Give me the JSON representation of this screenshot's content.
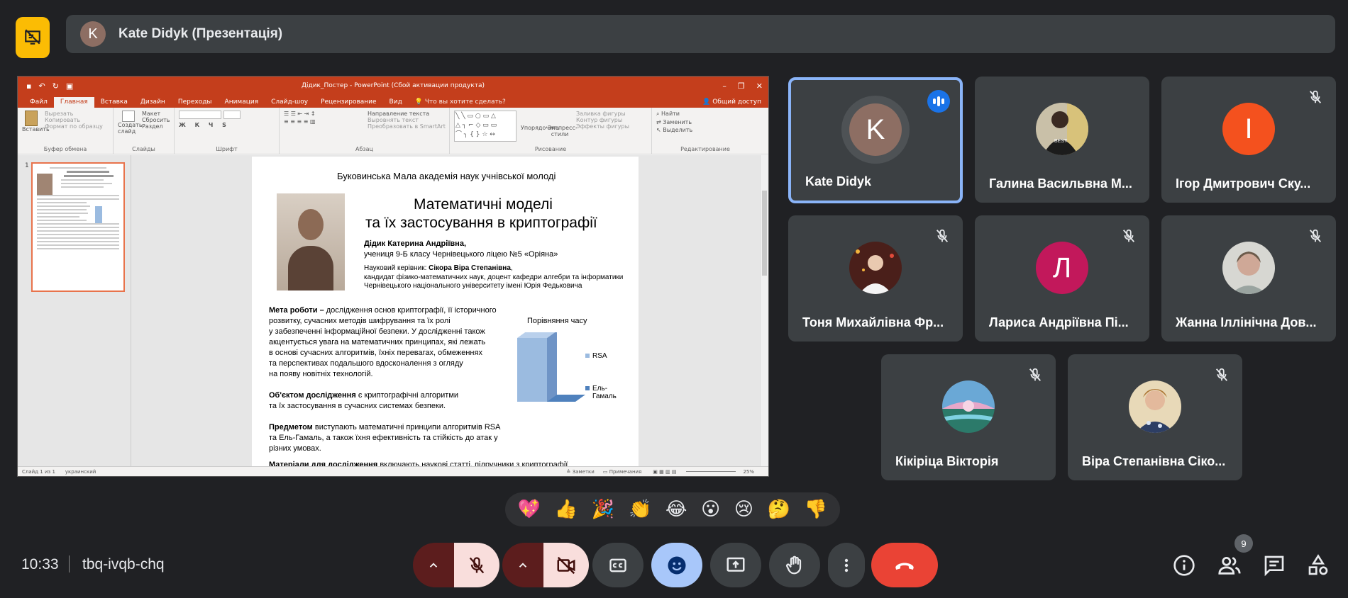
{
  "header": {
    "presenter_initial": "K",
    "presenting_title": "Kate Didyk (Презентація)"
  },
  "powerpoint": {
    "doc_title": "Дідик_Постер - PowerPoint (Сбой активации продукта)",
    "tabs": [
      "Файл",
      "Главная",
      "Вставка",
      "Дизайн",
      "Переходы",
      "Анимация",
      "Слайд-шоу",
      "Рецензирование",
      "Вид"
    ],
    "active_tab": "Главная",
    "tell_me": "Что вы хотите сделать?",
    "share": "Общий доступ",
    "ribbon": {
      "clipboard": {
        "paste": "Вставить",
        "cut": "Вырезать",
        "copy": "Копировать",
        "format_painter": "Формат по образцу",
        "label": "Буфер обмена"
      },
      "slides": {
        "new_slide": "Создать слайд",
        "layout": "Макет",
        "reset": "Сбросить",
        "section": "Раздел",
        "label": "Слайды"
      },
      "font": {
        "label": "Шрифт"
      },
      "paragraph": {
        "text_direction": "Направление текста",
        "align_text": "Выровнять текст",
        "smartart": "Преобразовать в SmartArt",
        "label": "Абзац"
      },
      "drawing": {
        "arrange": "Упорядочить",
        "quick_styles": "Экспресс-стили",
        "fill": "Заливка фигуры",
        "outline": "Контур фигуры",
        "effects": "Эффекты фигуры",
        "label": "Рисование"
      },
      "editing": {
        "find": "Найти",
        "replace": "Заменить",
        "select": "Выделить",
        "label": "Редактирование"
      }
    },
    "status": {
      "slide": "Слайд 1 из 1",
      "lang": "украинский",
      "notes": "Заметки",
      "comments": "Примечания",
      "zoom": "25%"
    },
    "slide_number": "1",
    "slide": {
      "academy": "Буковинська Мала академія наук учнівської молоді",
      "title_line1": "Математичні моделі",
      "title_line2": "та їх застосування в криптографії",
      "author": "Дідик Катерина Андріївна",
      "pupil": "учениця 9-Б класу Чернівецького ліцею №5 «Оріяна»",
      "supervisor_label": "Науковий керівник:",
      "supervisor_name": "Сікора Віра Степанівна",
      "degree_line1": "кандидат фізико-математичних наук,  доцент кафедри алгебри та інформатики",
      "degree_line2": "Чернівецького національного університету імені Юрія Федьковича",
      "aim_bold": "Мета роботи –",
      "aim_lines": [
        "дослідження основ криптографії, її історичного",
        "розвитку, сучасних методів шифрування та їх ролі",
        "у забезпеченні інформаційної безпеки. У дослідженні також",
        "акцентується увага на математичних принципах, які лежать",
        "в основі сучасних алгоритмів, їхніх перевагах, обмеженнях",
        "та перспективах подальшого вдосконалення з огляду",
        "на появу новітніх технологій."
      ],
      "object_bold": "Об'єктом дослідження",
      "object_lines": [
        "є криптографічні алгоритми",
        "та їх застосування в сучасних системах безпеки."
      ],
      "subject_bold": "Предметом",
      "subject_lines": [
        "виступають математичні принципи алгоритмів RSA",
        "та Ель-Гамаль, а також їхня ефективність та стійкість до атак у",
        "різних умовах."
      ],
      "materials_bold": "Матеріали для дослідження",
      "materials_rest": "включають наукові статті, підручники з криптографії"
    }
  },
  "chart_data": {
    "type": "bar",
    "title": "Порівняння часу",
    "categories": [
      ""
    ],
    "series": [
      {
        "name": "RSA",
        "values": [
          1
        ]
      },
      {
        "name": "Ель-Гамаль",
        "values": [
          0
        ]
      }
    ],
    "legend_labels": [
      "RSA",
      "Ель-",
      "Гамаль"
    ]
  },
  "participants": [
    {
      "name": "Kate Didyk",
      "initial": "K",
      "color": "#8d6e63",
      "speaking": true
    },
    {
      "name": "Галина Васильвна М...",
      "initial": "",
      "color": "#5d5d5d",
      "speaking": false
    },
    {
      "name": "Ігор Дмитрович Ску...",
      "initial": "I",
      "color": "#f4511e",
      "speaking": false
    },
    {
      "name": "Тоня Михайлівна Фр...",
      "initial": "",
      "color": "#6d4c41",
      "speaking": false
    },
    {
      "name": "Лариса Андріївна Пі...",
      "initial": "Л",
      "color": "#c2185b",
      "speaking": false
    },
    {
      "name": "Жанна Іллінічна Дов...",
      "initial": "",
      "color": "#bdbdbd",
      "speaking": false
    },
    {
      "name": "Кікіріца Вікторія",
      "initial": "",
      "color": "#4fa6c8",
      "speaking": false
    },
    {
      "name": "Віра Степанівна Сіко...",
      "initial": "",
      "color": "#b38b6d",
      "speaking": false
    }
  ],
  "reactions": [
    "💖",
    "👍",
    "🎉",
    "👏",
    "😂",
    "😮",
    "😢",
    "🤔",
    "👎"
  ],
  "footer": {
    "time": "10:33",
    "meeting_code": "tbq-ivqb-chq",
    "people_count": "9"
  },
  "colors": {
    "background": "#202124",
    "tile": "#3c4043",
    "accent": "#8ab4f8",
    "present": "#fbbc04",
    "end_call": "#ea4335",
    "powerpoint": "#c43e1c"
  }
}
